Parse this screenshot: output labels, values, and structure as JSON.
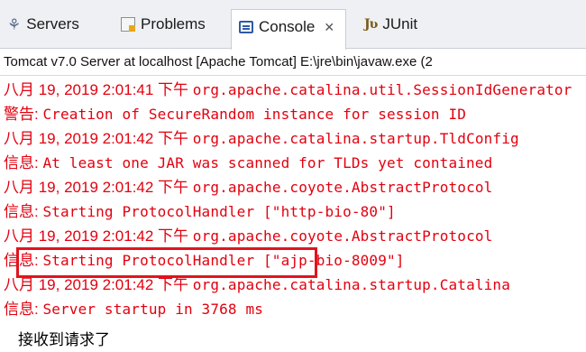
{
  "tabs": [
    {
      "label": "Servers",
      "icon": "servers-icon"
    },
    {
      "label": "Problems",
      "icon": "problems-icon"
    },
    {
      "label": "Console",
      "icon": "console-icon",
      "active": true
    },
    {
      "label": "JUnit",
      "icon": "junit-icon"
    }
  ],
  "console_tab_close": "✕",
  "junit_icon_text": "Jʋ",
  "header": "Tomcat v7.0 Server at localhost [Apache Tomcat] E:\\jre\\bin\\javaw.exe (2",
  "lines": [
    {
      "date": "八月 19, 2019 2:01:41 下午 ",
      "text": "org.apache.catalina.util.SessionIdGenerator"
    },
    {
      "date": "警告: ",
      "text": "Creation of SecureRandom instance for session ID"
    },
    {
      "date": "八月 19, 2019 2:01:42 下午 ",
      "text": "org.apache.catalina.startup.TldConfig"
    },
    {
      "date": "信息: ",
      "text": "At least one JAR was scanned for TLDs yet contained"
    },
    {
      "date": "八月 19, 2019 2:01:42 下午 ",
      "text": "org.apache.coyote.AbstractProtocol"
    },
    {
      "date": "信息: ",
      "text": "Starting ProtocolHandler [\"http-bio-80\"]"
    },
    {
      "date": "八月 19, 2019 2:01:42 下午 ",
      "text": "org.apache.coyote.AbstractProtocol"
    },
    {
      "date": "信息: ",
      "text": "Starting ProtocolHandler [\"ajp-bio-8009\"]"
    },
    {
      "date": "八月 19, 2019 2:01:42 下午 ",
      "text": "org.apache.catalina.startup.Catalina"
    },
    {
      "date": "信息: ",
      "text": "Server startup in 3768 ms"
    }
  ],
  "output_line": "接收到请求了",
  "colors": {
    "stderr": "#e3000f",
    "stdout": "#000000",
    "highlight_box": "#e0141e"
  }
}
